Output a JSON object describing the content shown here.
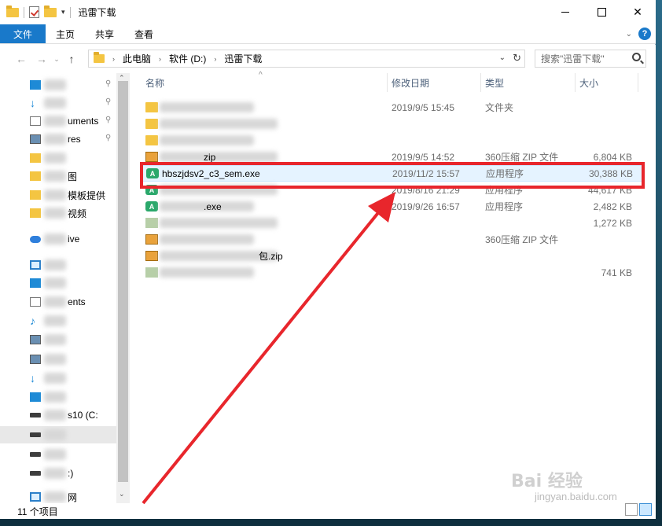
{
  "window": {
    "title": "迅雷下载"
  },
  "ribbon": {
    "tabs": [
      "文件",
      "主页",
      "共享",
      "查看"
    ],
    "help_label": "?"
  },
  "address": {
    "crumbs": [
      "此电脑",
      "软件 (D:)",
      "迅雷下载"
    ],
    "search_placeholder": "搜索\"迅雷下载\""
  },
  "navpane": {
    "items": [
      {
        "label": "",
        "icon": "desktop-icon",
        "pinned": true
      },
      {
        "label": "",
        "icon": "download-icon",
        "pinned": true
      },
      {
        "label": "uments",
        "icon": "documents-icon",
        "pinned": true
      },
      {
        "label": "res",
        "icon": "pictures-icon",
        "pinned": true
      },
      {
        "label": "",
        "icon": "folder-icon",
        "pinned": false
      },
      {
        "label": "图",
        "icon": "folder-icon",
        "pinned": false
      },
      {
        "label": "模板提供",
        "icon": "folder-icon",
        "pinned": false
      },
      {
        "label": "视频",
        "icon": "folder-icon",
        "pinned": false
      },
      {
        "label": "ive",
        "icon": "onedrive-icon",
        "pinned": false
      },
      {
        "label": "",
        "icon": "this-pc-icon",
        "pinned": false
      },
      {
        "label": "",
        "icon": "3d-objects-icon",
        "pinned": false
      },
      {
        "label": "ents",
        "icon": "documents-icon",
        "pinned": false
      },
      {
        "label": "",
        "icon": "music-icon",
        "pinned": false
      },
      {
        "label": "",
        "icon": "pictures-icon",
        "pinned": false
      },
      {
        "label": "",
        "icon": "videos-icon",
        "pinned": false
      },
      {
        "label": "",
        "icon": "downloads-icon",
        "pinned": false
      },
      {
        "label": "",
        "icon": "desktop-icon",
        "pinned": false
      },
      {
        "label": "s10 (C:",
        "icon": "drive-icon",
        "pinned": false
      },
      {
        "label": "",
        "icon": "drive-icon",
        "pinned": false
      },
      {
        "label": "",
        "icon": "drive-icon",
        "pinned": false
      },
      {
        "label": ":)",
        "icon": "drive-icon",
        "pinned": false
      },
      {
        "label": "网",
        "icon": "network-icon",
        "pinned": false
      }
    ]
  },
  "columns": {
    "name": "名称",
    "date": "修改日期",
    "type": "类型",
    "size": "大小"
  },
  "files": [
    {
      "name": "",
      "date": "2019/9/5 15:45",
      "type": "文件夹",
      "size": "",
      "icon": "folder-icon"
    },
    {
      "name": "",
      "date": "",
      "type": "",
      "size": "",
      "icon": "folder-icon"
    },
    {
      "name": "",
      "date": "",
      "type": "",
      "size": "",
      "icon": "folder-icon"
    },
    {
      "name": "zip",
      "date": "2019/9/5 14:52",
      "type": "360压缩 ZIP 文件",
      "size": "6,804 KB",
      "icon": "zip-icon"
    },
    {
      "name": "hbszjdsv2_c3_sem.exe",
      "date": "2019/11/2 15:57",
      "type": "应用程序",
      "size": "30,388 KB",
      "icon": "app-icon"
    },
    {
      "name": "",
      "date": "2019/8/16 21:29",
      "type": "应用程序",
      "size": "44,617 KB",
      "icon": "app-icon"
    },
    {
      "name": ".exe",
      "date": "2019/9/26 16:57",
      "type": "应用程序",
      "size": "2,482 KB",
      "icon": "app-icon"
    },
    {
      "name": "",
      "date": "",
      "type": "",
      "size": "1,272 KB",
      "icon": "file-icon"
    },
    {
      "name": "",
      "date": "",
      "type": "360压缩 ZIP 文件",
      "size": "",
      "icon": "zip-icon"
    },
    {
      "name": "包.zip",
      "date": "",
      "type": "",
      "size": "",
      "icon": "zip-icon"
    },
    {
      "name": "",
      "date": "",
      "type": "",
      "size": "741 KB",
      "icon": "file-icon"
    }
  ],
  "status": {
    "count": "11 个项目"
  },
  "watermark": {
    "brand": "Bai 经验",
    "url": "jingyan.baidu.com"
  },
  "colors": {
    "accent": "#1979ca",
    "highlight_box": "#e8262c"
  }
}
